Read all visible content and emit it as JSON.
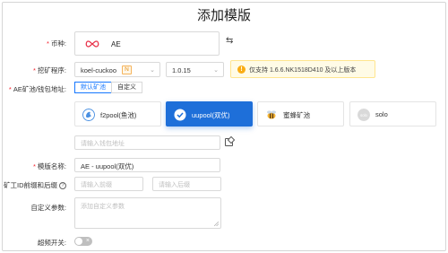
{
  "page": {
    "title": "添加模版"
  },
  "coin": {
    "label": "币种:",
    "required_mark": "*",
    "name": "AE"
  },
  "program": {
    "label": "挖矿程序:",
    "required_mark": "*",
    "value": "koel-cuckoo",
    "badge": "N",
    "version": "1.0.15",
    "warning": "仅支持 1.6.6.NK1518D410 及以上版本"
  },
  "address": {
    "label": "AE矿池/钱包地址:",
    "required_mark": "*",
    "tabs": [
      {
        "label": "默认矿池",
        "active": true
      },
      {
        "label": "自定义",
        "active": false
      }
    ],
    "pools": [
      {
        "name": "f2pool(鱼池)",
        "icon": "f2pool-fish-icon",
        "active": false
      },
      {
        "name": "uupool(双优)",
        "icon": "check-icon",
        "active": true
      },
      {
        "name": "蜜蜂矿池",
        "icon": "bee-icon",
        "active": false
      },
      {
        "name": "solo",
        "icon": "solo-icon",
        "icon_text": "solo",
        "active": false
      }
    ],
    "wallet_placeholder": "请输入钱包地址"
  },
  "template_name": {
    "label": "模版名称:",
    "required_mark": "*",
    "value": "AE - uupool(双优)"
  },
  "worker_id": {
    "label": "矿工ID前缀和后缀",
    "help": "?",
    "prefix_placeholder": "请输入前缀",
    "suffix_placeholder": "请输入后缀"
  },
  "custom_params": {
    "label": "自定义参数:",
    "placeholder": "添加自定义参数"
  },
  "overclock": {
    "label": "超频开关:",
    "enabled": false
  },
  "colors": {
    "accent": "#1e6fd9",
    "required": "#f5222d",
    "warning_bg": "#fffbe6",
    "warning_icon": "#faad14"
  }
}
